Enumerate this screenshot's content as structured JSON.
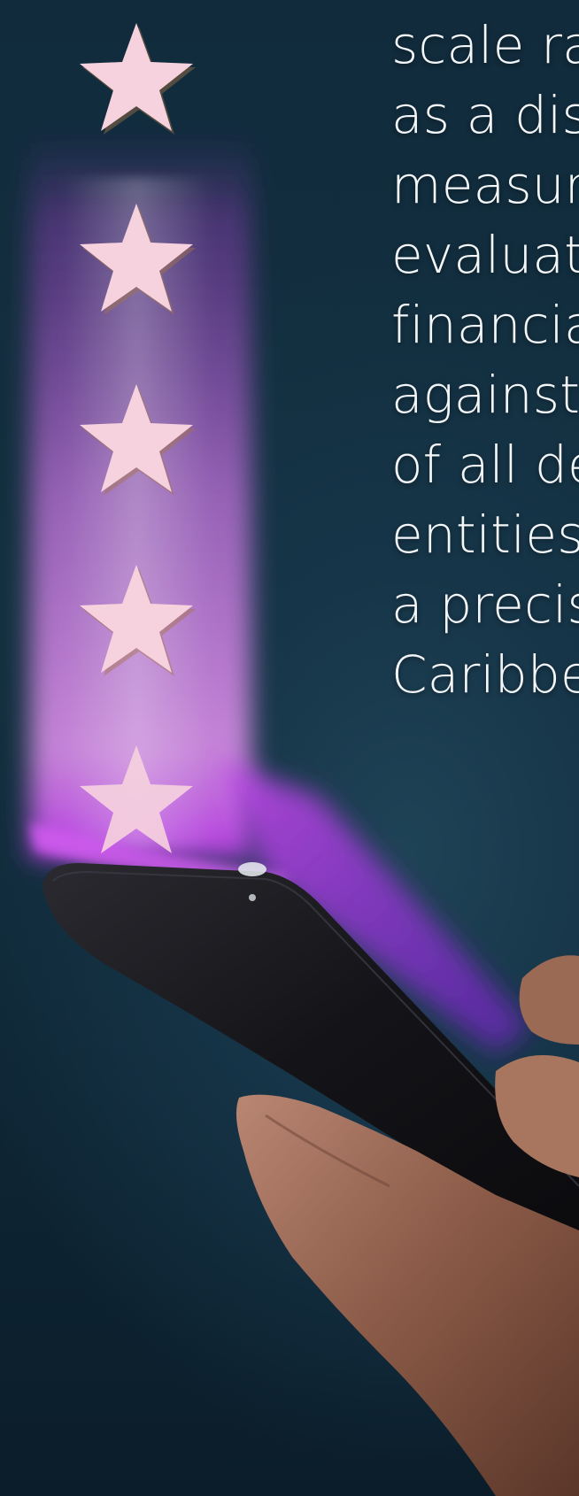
{
  "headline_lines": [
    "scale ra",
    "as a disc",
    "measure",
    "evaluati",
    "financia",
    "against",
    "of all de",
    "entities",
    "a precis",
    "Caribbe"
  ],
  "rating": {
    "stars": 5
  },
  "colors": {
    "background": "#12303f",
    "glow": "#b04cd8",
    "star": "#f6d2de",
    "text": "#f4f7fa"
  },
  "icons": [
    "star-icon",
    "smartphone",
    "hand"
  ]
}
